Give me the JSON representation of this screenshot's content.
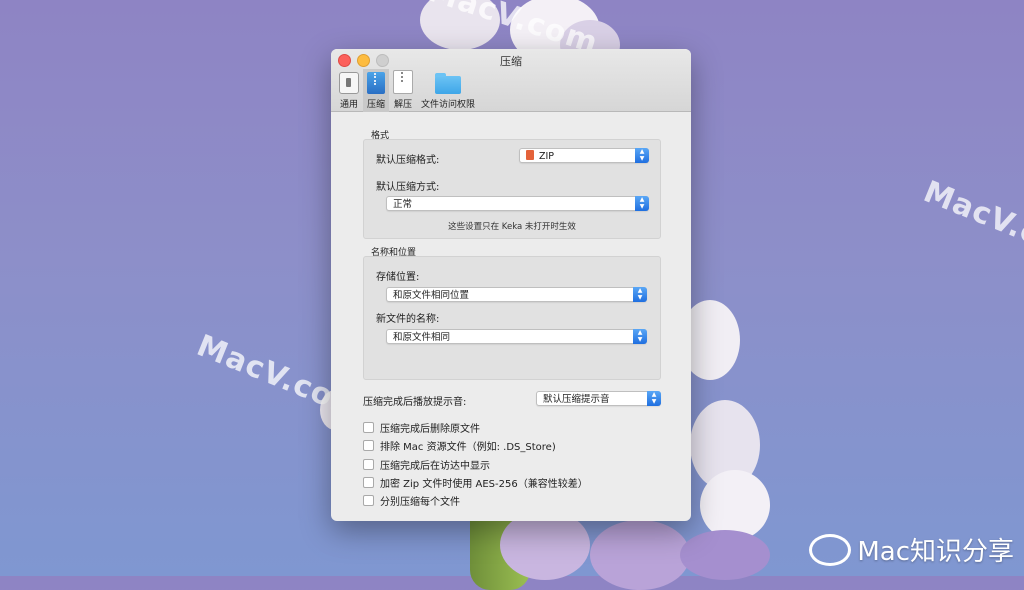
{
  "window": {
    "title": "压缩",
    "tabs": [
      {
        "label": "通用",
        "icon": "general-icon"
      },
      {
        "label": "压缩",
        "icon": "zip-icon"
      },
      {
        "label": "解压",
        "icon": "unzip-icon"
      },
      {
        "label": "文件访问权限",
        "icon": "folder-icon"
      }
    ]
  },
  "format": {
    "section_label": "格式",
    "default_format_label": "默认压缩格式:",
    "default_format_value": "ZIP",
    "default_method_label": "默认压缩方式:",
    "default_method_value": "正常",
    "note": "这些设置只在 Keka 未打开时生效"
  },
  "naming": {
    "section_label": "名称和位置",
    "location_label": "存储位置:",
    "location_value": "和原文件相同位置",
    "new_name_label": "新文件的名称:",
    "new_name_value": "和原文件相同"
  },
  "sound": {
    "label": "压缩完成后播放提示音:",
    "value": "默认压缩提示音"
  },
  "options": [
    {
      "label": "压缩完成后删除原文件",
      "checked": false
    },
    {
      "label": "排除 Mac 资源文件（例如: .DS_Store)",
      "checked": false
    },
    {
      "label": "压缩完成后在访达中显示",
      "checked": false
    },
    {
      "label": "加密 Zip 文件时使用 AES-256（兼容性较差）",
      "checked": false
    },
    {
      "label": "分别压缩每个文件",
      "checked": false
    }
  ],
  "watermarks": [
    "MacV.com",
    "MacV.co",
    "MacV.com"
  ],
  "brand": "Mac知识分享"
}
